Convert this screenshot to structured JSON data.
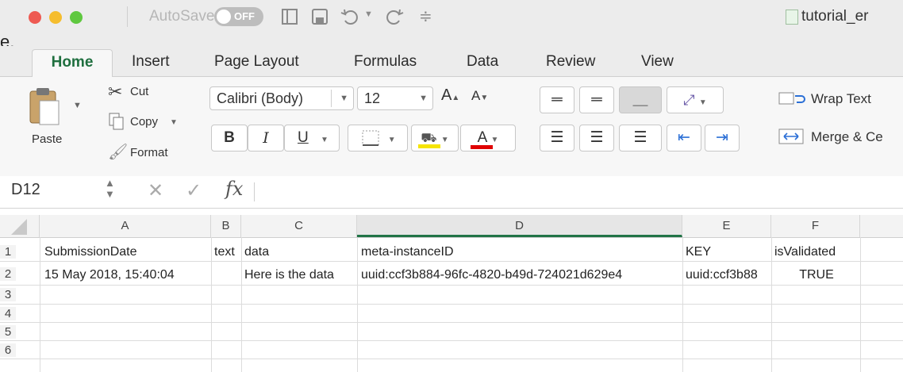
{
  "titlebar": {
    "autosave_label": "AutoSave",
    "autosave_state": "OFF",
    "doc_title": "tutorial_er",
    "clipped_text": "e."
  },
  "tabs": [
    "Home",
    "Insert",
    "Page Layout",
    "Formulas",
    "Data",
    "Review",
    "View"
  ],
  "ribbon": {
    "paste": "Paste",
    "cut": "Cut",
    "copy": "Copy",
    "format": "Format",
    "font_name": "Calibri (Body)",
    "font_size": "12",
    "bold": "B",
    "italic": "I",
    "underline": "U",
    "grow": "A",
    "shrink": "A",
    "font_color_letter": "A",
    "wrap_text": "Wrap Text",
    "merge": "Merge & Ce",
    "highlight_color": "#f5e400",
    "font_color": "#e00000"
  },
  "formula_bar": {
    "name_box": "D12",
    "fx": "fx"
  },
  "sheet": {
    "columns": [
      "A",
      "B",
      "C",
      "D",
      "E",
      "F"
    ],
    "selected_column": "D",
    "rows": [
      "1",
      "2",
      "3",
      "4",
      "5",
      "6"
    ],
    "row1": [
      "SubmissionDate",
      "text",
      "data",
      "meta-instanceID",
      "KEY",
      "isValidated"
    ],
    "row2": [
      "15 May 2018, 15:40:04",
      "",
      "Here is the data",
      "uuid:ccf3b884-96fc-4820-b49d-724021d629e4",
      "uuid:ccf3b88",
      "TRUE"
    ]
  },
  "colors": {
    "accent_green": "#217346",
    "close": "#ee5a52",
    "minimize": "#f5bd2e",
    "zoom": "#5fc83f"
  }
}
